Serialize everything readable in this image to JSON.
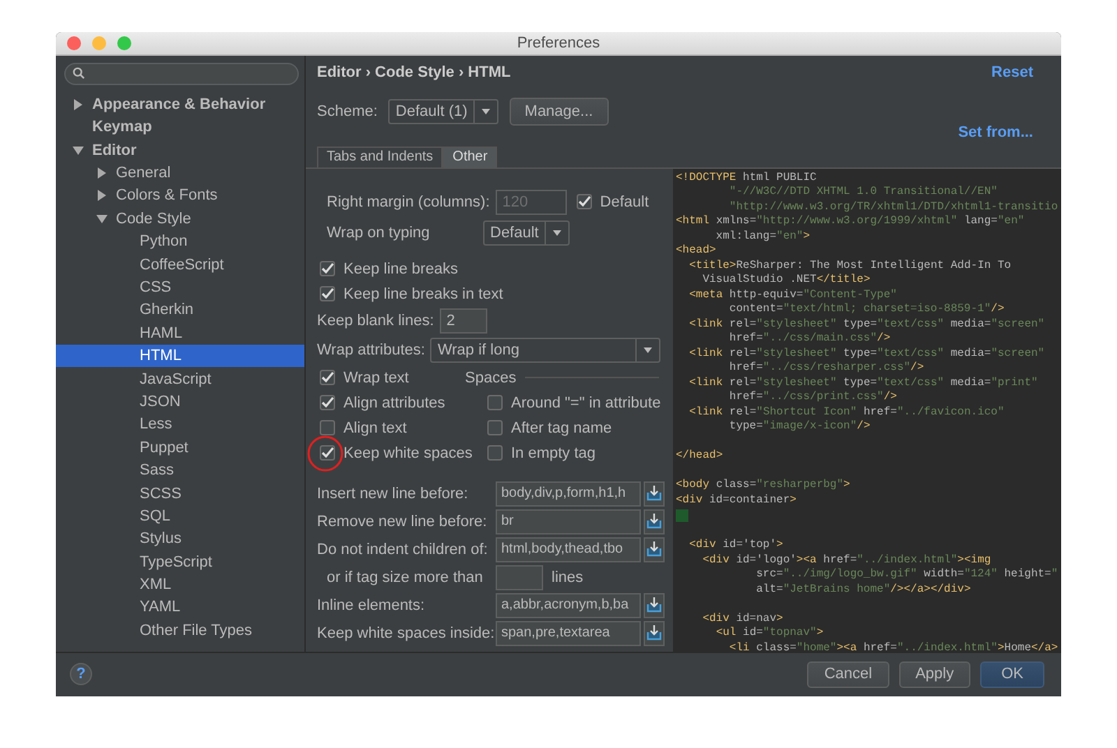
{
  "window": {
    "title": "Preferences"
  },
  "sidebar": {
    "items": [
      {
        "label": "Appearance & Behavior",
        "expanded": false,
        "selected": false
      },
      {
        "label": "Keymap",
        "selected": false
      },
      {
        "label": "Editor",
        "expanded": true,
        "selected": false,
        "children": [
          {
            "label": "General",
            "expanded": false,
            "selected": false
          },
          {
            "label": "Colors & Fonts",
            "expanded": false,
            "selected": false
          },
          {
            "label": "Code Style",
            "expanded": true,
            "selected": false,
            "children": [
              {
                "label": "Python",
                "selected": false
              },
              {
                "label": "CoffeeScript",
                "selected": false
              },
              {
                "label": "CSS",
                "selected": false
              },
              {
                "label": "Gherkin",
                "selected": false
              },
              {
                "label": "HAML",
                "selected": false
              },
              {
                "label": "HTML",
                "selected": true
              },
              {
                "label": "JavaScript",
                "selected": false
              },
              {
                "label": "JSON",
                "selected": false
              },
              {
                "label": "Less",
                "selected": false
              },
              {
                "label": "Puppet",
                "selected": false
              },
              {
                "label": "Sass",
                "selected": false
              },
              {
                "label": "SCSS",
                "selected": false
              },
              {
                "label": "SQL",
                "selected": false
              },
              {
                "label": "Stylus",
                "selected": false
              },
              {
                "label": "TypeScript",
                "selected": false
              },
              {
                "label": "XML",
                "selected": false
              },
              {
                "label": "YAML",
                "selected": false
              },
              {
                "label": "Other File Types",
                "selected": false
              }
            ]
          }
        ]
      }
    ]
  },
  "breadcrumb": [
    "Editor",
    "Code Style",
    "HTML"
  ],
  "breadcrumb_separator": "›",
  "reset": "Reset",
  "scheme": {
    "label": "Scheme:",
    "value": "Default (1)",
    "manage": "Manage...",
    "set_from": "Set from..."
  },
  "tabs": [
    {
      "label": "Tabs and Indents",
      "selected": false
    },
    {
      "label": "Other",
      "selected": true
    }
  ],
  "settings": {
    "right_margin": {
      "label": "Right margin (columns):",
      "value": "120",
      "disabled": true,
      "default": {
        "label": "Default",
        "checked": true
      }
    },
    "wrap_on_typing": {
      "label": "Wrap on typing",
      "value": "Default"
    },
    "line_checks": [
      {
        "label": "Keep line breaks",
        "checked": true
      },
      {
        "label": "Keep line breaks in text",
        "checked": true
      }
    ],
    "keep_blank_lines": {
      "label": "Keep blank lines:",
      "value": "2"
    },
    "wrap_attributes": {
      "label": "Wrap attributes:",
      "value": "Wrap if long"
    },
    "text_checks": [
      {
        "label": "Wrap text",
        "checked": true
      },
      {
        "label": "Align attributes",
        "checked": true
      },
      {
        "label": "Align text",
        "checked": false
      },
      {
        "label": "Keep white spaces",
        "checked": true,
        "highlighted": true
      }
    ],
    "spaces": {
      "title": "Spaces",
      "checks": [
        {
          "label": "Around \"=\" in attribute",
          "checked": false
        },
        {
          "label": "After tag name",
          "checked": false
        },
        {
          "label": "In empty tag",
          "checked": false
        }
      ]
    },
    "fields": [
      {
        "kind": "list",
        "label": "Insert new line before:",
        "value": "body,div,p,form,h1,h"
      },
      {
        "kind": "list",
        "label": "Remove new line before:",
        "value": "br"
      },
      {
        "kind": "list",
        "label": "Do not indent children of:",
        "value": "html,body,thead,tbo"
      },
      {
        "kind": "size",
        "label": "or if tag size more than",
        "unit": "lines"
      },
      {
        "kind": "list",
        "label": "Inline elements:",
        "value": "a,abbr,acronym,b,ba"
      },
      {
        "kind": "list",
        "label": "Keep white spaces inside:",
        "value": "span,pre,textarea"
      }
    ]
  },
  "code": [
    {
      "kind": "code",
      "text": "<!DOCTYPE html PUBLIC"
    },
    {
      "kind": "code",
      "text": "        \"-//W3C//DTD XHTML 1.0 Transitional//EN\""
    },
    {
      "kind": "code",
      "text": "        \"http://www.w3.org/TR/xhtml1/DTD/xhtml1-transitio"
    },
    {
      "kind": "code",
      "text": "<html xmlns=\"http://www.w3.org/1999/xhtml\" lang=\"en\""
    },
    {
      "kind": "code",
      "text": "      xml:lang=\"en\">"
    },
    {
      "kind": "code",
      "text": "<head>"
    },
    {
      "kind": "code",
      "text": "  <title>ReSharper: The Most Intelligent Add-In To"
    },
    {
      "kind": "code",
      "text": "    VisualStudio .NET</title>"
    },
    {
      "kind": "code",
      "text": "  <meta http-equiv=\"Content-Type\""
    },
    {
      "kind": "code",
      "text": "        content=\"text/html; charset=iso-8859-1\"/>"
    },
    {
      "kind": "code",
      "text": "  <link rel=\"stylesheet\" type=\"text/css\" media=\"screen\""
    },
    {
      "kind": "code",
      "text": "        href=\"../css/main.css\"/>"
    },
    {
      "kind": "code",
      "text": "  <link rel=\"stylesheet\" type=\"text/css\" media=\"screen\""
    },
    {
      "kind": "code",
      "text": "        href=\"../css/resharper.css\"/>"
    },
    {
      "kind": "code",
      "text": "  <link rel=\"stylesheet\" type=\"text/css\" media=\"print\""
    },
    {
      "kind": "code",
      "text": "        href=\"../css/print.css\"/>"
    },
    {
      "kind": "code",
      "text": "  <link rel=\"Shortcut Icon\" href=\"../favicon.ico\""
    },
    {
      "kind": "code",
      "text": "        type=\"image/x-icon\"/>"
    },
    {
      "kind": "blank"
    },
    {
      "kind": "code",
      "text": "</head>"
    },
    {
      "kind": "blank"
    },
    {
      "kind": "code",
      "text": "<body class=\"resharperbg\">"
    },
    {
      "kind": "code",
      "text": "<div id=container>"
    },
    {
      "kind": "caret"
    },
    {
      "kind": "blank"
    },
    {
      "kind": "code",
      "text": "  <div id='top'>"
    },
    {
      "kind": "code",
      "text": "    <div id='logo'><a href=\"../index.html\"><img"
    },
    {
      "kind": "code",
      "text": "            src=\"../img/logo_bw.gif\" width=\"124\" height=\""
    },
    {
      "kind": "code",
      "text": "            alt=\"JetBrains home\"/></a></div>"
    },
    {
      "kind": "blank"
    },
    {
      "kind": "code",
      "text": "    <div id=nav>"
    },
    {
      "kind": "code",
      "text": "      <ul id=\"topnav\">"
    },
    {
      "kind": "code",
      "text": "        <li class=\"home\"><a href=\"../index.html\">Home</a>"
    }
  ],
  "help": "?",
  "buttons": [
    {
      "label": "Cancel",
      "default": false
    },
    {
      "label": "Apply",
      "default": false
    },
    {
      "label": "OK",
      "default": true
    }
  ]
}
